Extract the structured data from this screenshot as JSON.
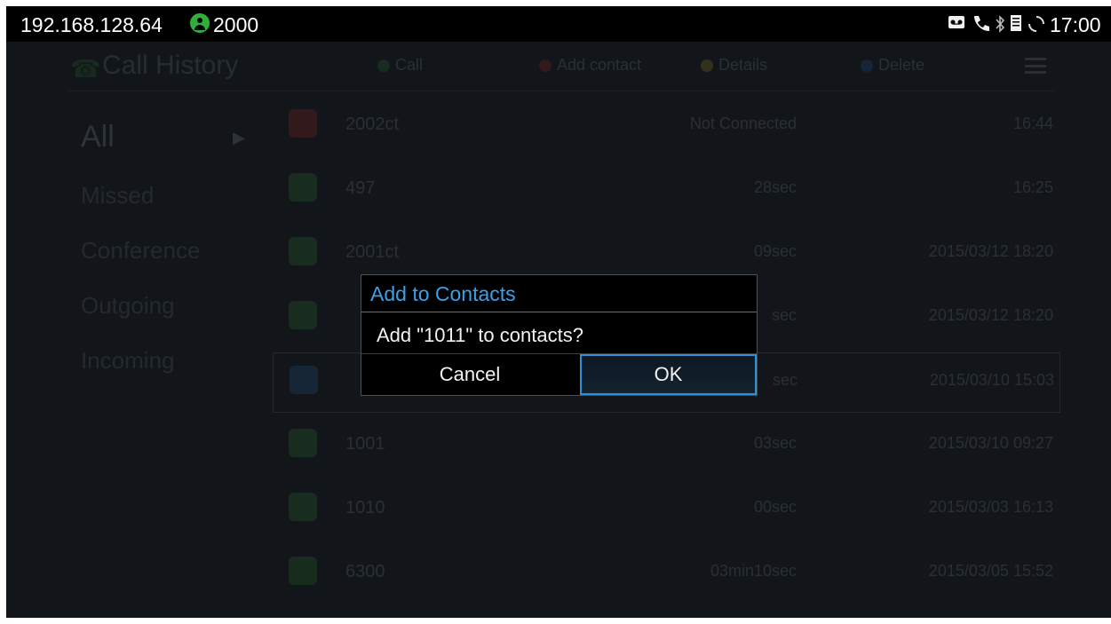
{
  "status_bar": {
    "ip": "192.168.128.64",
    "account": "2000",
    "account_icon_color": "#2fae3a",
    "icons": [
      "voicemail-icon",
      "phone-icon",
      "bluetooth-icon",
      "sd-card-icon",
      "sync-icon"
    ],
    "time": "17:00"
  },
  "app": {
    "title": "Call History",
    "toolbar": {
      "call": "Call",
      "add_contact": "Add contact",
      "details": "Details",
      "delete": "Delete"
    },
    "sidebar": [
      {
        "label": "All",
        "selected": true
      },
      {
        "label": "Missed"
      },
      {
        "label": "Conference"
      },
      {
        "label": "Outgoing"
      },
      {
        "label": "Incoming"
      }
    ],
    "calls": [
      {
        "name": "2002ct",
        "duration": "Not Connected",
        "time": "16:44",
        "type": "missed",
        "color": "#d9342b"
      },
      {
        "name": "497",
        "duration": "28sec",
        "time": "16:25",
        "type": "outgoing",
        "color": "#3aa03a"
      },
      {
        "name": "2001ct",
        "duration": "09sec",
        "time": "2015/03/12 18:20",
        "type": "outgoing",
        "color": "#3aa03a"
      },
      {
        "name": "",
        "duration": "sec",
        "time": "2015/03/12 18:20",
        "type": "outgoing",
        "color": "#3aa03a"
      },
      {
        "name": "",
        "duration": "sec",
        "time": "2015/03/10 15:03",
        "type": "incoming",
        "color": "#2f78c8",
        "selected": true
      },
      {
        "name": "1001",
        "duration": "03sec",
        "time": "2015/03/10 09:27",
        "type": "outgoing",
        "color": "#3aa03a"
      },
      {
        "name": "1010",
        "duration": "00sec",
        "time": "2015/03/03 16:13",
        "type": "outgoing",
        "color": "#3aa03a"
      },
      {
        "name": "6300",
        "duration": "03min10sec",
        "time": "2015/03/05 15:52",
        "type": "outgoing",
        "color": "#3aa03a"
      }
    ]
  },
  "dialog": {
    "title": "Add to Contacts",
    "message": "Add \"1011\" to contacts?",
    "cancel_label": "Cancel",
    "ok_label": "OK",
    "accent_color": "#3aa0e8"
  }
}
